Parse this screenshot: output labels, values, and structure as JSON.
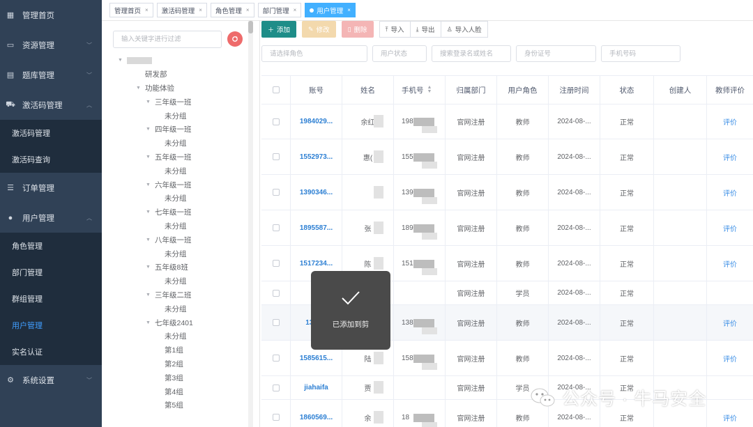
{
  "sidebar": {
    "items": [
      {
        "label": "管理首页",
        "icon": "dashboard-icon",
        "arrow": false
      },
      {
        "label": "资源管理",
        "icon": "monitor-icon",
        "arrow": true
      },
      {
        "label": "题库管理",
        "icon": "document-icon",
        "arrow": true
      },
      {
        "label": "激活码管理",
        "icon": "cart-icon",
        "arrow": true,
        "expanded": true
      }
    ],
    "activation_sub": [
      "激活码管理",
      "激活码查询"
    ],
    "items2": [
      {
        "label": "订单管理",
        "icon": "list-icon",
        "arrow": false
      },
      {
        "label": "用户管理",
        "icon": "user-icon",
        "arrow": true,
        "expanded": true
      }
    ],
    "user_sub": [
      "角色管理",
      "部门管理",
      "群组管理",
      "用户管理",
      "实名认证"
    ],
    "active_sub": "用户管理",
    "items3": [
      {
        "label": "系统设置",
        "icon": "gear-icon",
        "arrow": true
      }
    ]
  },
  "tags": [
    {
      "label": "管理首页",
      "active": false
    },
    {
      "label": "激活码管理",
      "active": false
    },
    {
      "label": "角色管理",
      "active": false
    },
    {
      "label": "部门管理",
      "active": false
    },
    {
      "label": "用户管理",
      "active": true
    }
  ],
  "tree": {
    "filter_placeholder": "输入关键字进行过滤",
    "nodes": [
      {
        "label": "",
        "level": 0,
        "caret": true,
        "blurred": true
      },
      {
        "label": "研发部",
        "level": 1,
        "caret": false
      },
      {
        "label": "功能体验",
        "level": 1,
        "caret": true
      },
      {
        "label": "三年级一班",
        "level": 2,
        "caret": true
      },
      {
        "label": "未分组",
        "level": 3,
        "caret": false
      },
      {
        "label": "四年级一班",
        "level": 2,
        "caret": true
      },
      {
        "label": "未分组",
        "level": 3,
        "caret": false
      },
      {
        "label": "五年级一班",
        "level": 2,
        "caret": true
      },
      {
        "label": "未分组",
        "level": 3,
        "caret": false
      },
      {
        "label": "六年级一班",
        "level": 2,
        "caret": true
      },
      {
        "label": "未分组",
        "level": 3,
        "caret": false
      },
      {
        "label": "七年级一班",
        "level": 2,
        "caret": true
      },
      {
        "label": "未分组",
        "level": 3,
        "caret": false
      },
      {
        "label": "八年级一班",
        "level": 2,
        "caret": true
      },
      {
        "label": "未分组",
        "level": 3,
        "caret": false
      },
      {
        "label": "五年级8班",
        "level": 2,
        "caret": true
      },
      {
        "label": "未分组",
        "level": 3,
        "caret": false
      },
      {
        "label": "三年级二班",
        "level": 2,
        "caret": true
      },
      {
        "label": "未分组",
        "level": 3,
        "caret": false
      },
      {
        "label": "七年级2401",
        "level": 2,
        "caret": true
      },
      {
        "label": "未分组",
        "level": 3,
        "caret": false
      },
      {
        "label": "第1组",
        "level": 3,
        "caret": false
      },
      {
        "label": "第2组",
        "level": 3,
        "caret": false
      },
      {
        "label": "第3组",
        "level": 3,
        "caret": false
      },
      {
        "label": "第4组",
        "level": 3,
        "caret": false
      },
      {
        "label": "第5组",
        "level": 3,
        "caret": false
      }
    ]
  },
  "toolbar": {
    "add": "添加",
    "edit": "修改",
    "delete": "删除",
    "import": "导入",
    "export": "导出",
    "import_face": "导入人脸"
  },
  "search": {
    "role": "请选择角色",
    "status": "用户状态",
    "login": "搜索登录名或姓名",
    "idcard": "身份证号",
    "phone": "手机号码"
  },
  "table": {
    "headers": [
      "账号",
      "姓名",
      "手机号",
      "归属部门",
      "用户角色",
      "注册时间",
      "状态",
      "创建人",
      "教师评价"
    ],
    "rows": [
      {
        "account": "1984029...",
        "name": "余红",
        "phone": "198",
        "dept": "官网注册",
        "role": "教师",
        "time": "2024-08-...",
        "status": "正常",
        "creator": "",
        "eval": "评价",
        "h": 50
      },
      {
        "account": "1552973...",
        "name": "惠(",
        "phone": "155",
        "dept": "官网注册",
        "role": "教师",
        "time": "2024-08-...",
        "status": "正常",
        "creator": "",
        "eval": "评价",
        "h": 51
      },
      {
        "account": "1390346...",
        "name": "",
        "phone": "1390",
        "dept": "官网注册",
        "role": "教师",
        "time": "2024-08-...",
        "status": "正常",
        "creator": "",
        "eval": "评价",
        "h": 51
      },
      {
        "account": "1895587...",
        "name": "张",
        "phone": "1895",
        "dept": "官网注册",
        "role": "教师",
        "time": "2024-08-...",
        "status": "正常",
        "creator": "",
        "eval": "评价",
        "h": 51
      },
      {
        "account": "1517234...",
        "name": "陈",
        "phone": "1517",
        "dept": "官网注册",
        "role": "教师",
        "time": "2024-08-...",
        "status": "正常",
        "creator": "",
        "eval": "评价",
        "h": 51
      },
      {
        "account": "",
        "name": "",
        "phone": "",
        "dept": "官网注册",
        "role": "学员",
        "time": "2024-08-...",
        "status": "正常",
        "creator": "",
        "eval": "",
        "h": 34
      },
      {
        "account": "1383...",
        "name": "",
        "phone": "138",
        "dept": "官网注册",
        "role": "教师",
        "time": "2024-08-...",
        "status": "正常",
        "creator": "",
        "eval": "评价",
        "h": 51,
        "hl": true
      },
      {
        "account": "1585615...",
        "name": "陆",
        "phone": "158",
        "dept": "官网注册",
        "role": "教师",
        "time": "2024-08-...",
        "status": "正常",
        "creator": "",
        "eval": "评价",
        "h": 51
      },
      {
        "account": "jiahaifa",
        "name": "贾",
        "phone": "",
        "dept": "官网注册",
        "role": "学员",
        "time": "2024-08-...",
        "status": "正常",
        "creator": "",
        "eval": "",
        "h": 34
      },
      {
        "account": "1860569...",
        "name": "余",
        "phone": "18",
        "dept": "官网注册",
        "role": "教师",
        "time": "2024-08-...",
        "status": "正常",
        "creator": "",
        "eval": "评价",
        "h": 51
      }
    ]
  },
  "toast": {
    "message": "已添加到剪",
    "icon": "check-icon"
  },
  "watermark": {
    "text": "公众号 · 牛马安全",
    "icon": "wechat-icon"
  }
}
